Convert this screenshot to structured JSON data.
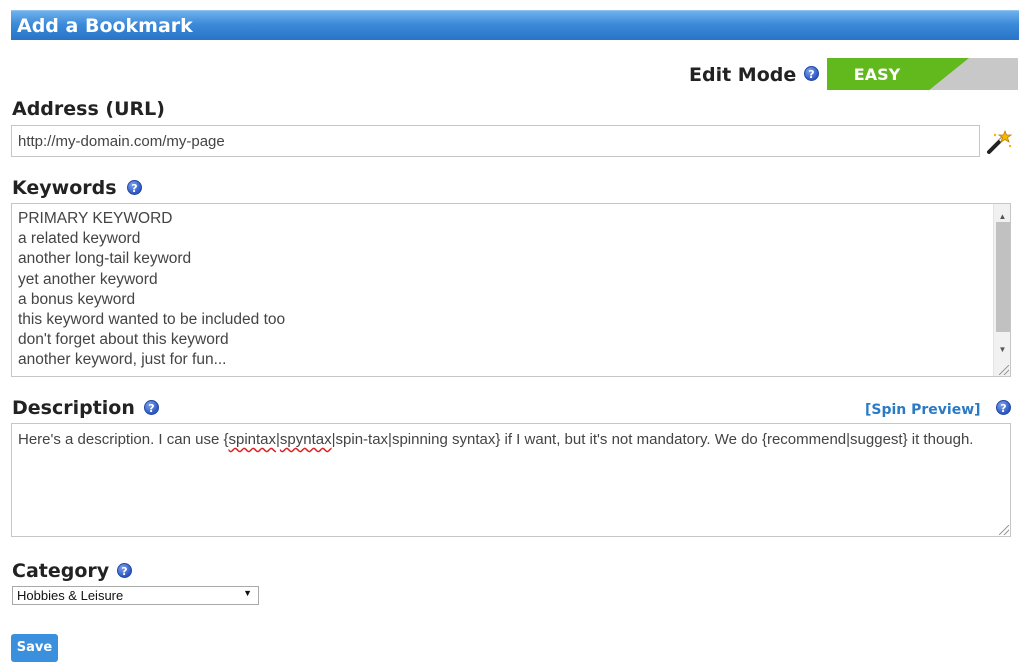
{
  "header": {
    "title": "Add a Bookmark"
  },
  "edit_mode": {
    "label": "Edit Mode",
    "value": "EASY",
    "help": "?"
  },
  "address": {
    "label": "Address (URL)",
    "value": "http://my-domain.com/my-page"
  },
  "keywords": {
    "label": "Keywords",
    "help": "?",
    "lines": [
      "PRIMARY KEYWORD",
      "a related keyword",
      "another long-tail keyword",
      "yet another keyword",
      "a bonus keyword",
      "this keyword wanted to be included too",
      "don't forget about this keyword",
      "another keyword, just for fun..."
    ]
  },
  "description": {
    "label": "Description",
    "help": "?",
    "spin_preview": "[Spin Preview]",
    "text_parts": {
      "p1": "Here's a description. I can use {",
      "w1": "spintax",
      "p2": "|",
      "w2": "spyntax",
      "p3": "|spin-tax|spinning syntax} if I want, but it's not mandatory.  We do {recommend|suggest} it though."
    }
  },
  "category": {
    "label": "Category",
    "help": "?",
    "selected": "Hobbies & Leisure"
  },
  "actions": {
    "save_label": "Save"
  },
  "colors": {
    "accent_blue": "#3a90dd",
    "easy_green": "#62b91d",
    "link_blue": "#2a7ac4"
  },
  "icons": {
    "wand": "magic-wand-icon",
    "help": "help-circle-icon"
  }
}
